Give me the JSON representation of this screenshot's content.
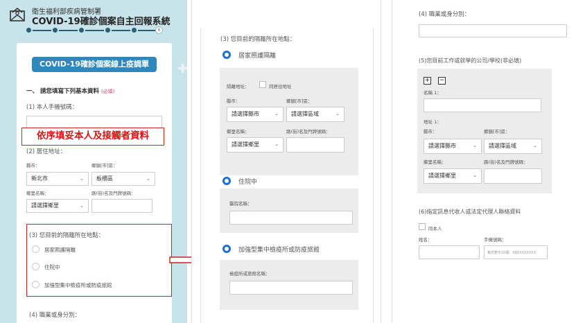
{
  "header": {
    "org": "衛生福利部疾病管制署",
    "system_title": "COVID-19確診個案自主回報系統",
    "final_step": "6"
  },
  "form_card": {
    "title": "COVID-19確診個案線上疫調單",
    "section1": "一、 請您填寫下列基本資料",
    "required_tag": "(必填)",
    "q1": "(1) 本人手機號碼：",
    "q2": "(2) 居住地址：",
    "county_label": "縣市：",
    "district_label": "鄉鎮[市]區：",
    "county_value": "新北市",
    "district_value": "板橋區",
    "village_label": "鄉里名稱：",
    "road_label": "路(街)名及門牌號碼：",
    "village_value": "請選擇鄉里",
    "q3": "(3) 您目前的隔離所在地點：",
    "opt1": "居家照護隔離",
    "opt2": "住院中",
    "opt3": "加強型集中檢疫所或防疫旅館",
    "q4": "(4) 職業或身分別："
  },
  "banner": "依序填妥本人及接觸者資料",
  "panel2": {
    "q3": "(3) 您目前的隔離所在地點：",
    "opt1": "居家照護隔離",
    "isolation_addr_label": "隔離地址：",
    "same_as_home": "同居住地址",
    "county_label": "縣市：",
    "district_label": "鄉鎮[市]區：",
    "county_placeholder": "請選擇縣市",
    "district_placeholder": "請選擇區域",
    "village_label": "鄉里名稱：",
    "road_label": "路(街)名及門牌號碼：",
    "village_placeholder": "請選擇鄉里",
    "opt2": "住院中",
    "hospital_label": "醫院名稱：",
    "opt3": "加強型集中檢疫所或防疫旅館",
    "quarantine_label": "檢疫所或旅館名稱："
  },
  "panel3": {
    "q4": "(4) 職業或身分別：",
    "q5": "(5)您目前工作或就學的公司/學校(非必填)",
    "plus": "+",
    "minus": "−",
    "name_label": "名稱 1：",
    "addr_label": "地址 1：",
    "county_label": "縣市：",
    "district_label": "鄉鎮[市]區：",
    "county_placeholder": "請選擇縣市",
    "district_placeholder": "請選擇區域",
    "village_label": "鄉里名稱：",
    "road_label": "路(街)名及門牌號碼：",
    "village_placeholder": "請選擇鄉里",
    "q6": "(6)指定訊息代收人或法定代理人聯絡資料",
    "self_label": "同本人",
    "name2_label": "姓名：",
    "phone_label": "手機號碼：",
    "phone_placeholder": "格式數字10碼：09XXXXXXXX"
  },
  "colors": {
    "accent": "#2e88bd",
    "highlight": "#cc2222",
    "radio": "#1e6fd0",
    "panel_bg": "#c9e3ea"
  }
}
